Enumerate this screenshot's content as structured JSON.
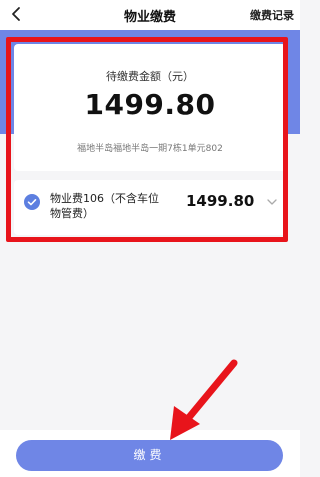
{
  "header": {
    "title": "物业缴费",
    "history_label": "缴费记录",
    "back_icon": "chevron-left-icon"
  },
  "summary": {
    "amount_label": "待缴费金额（元）",
    "amount": "1499.80",
    "address": "福地半岛福地半岛一期7栋1单元802"
  },
  "fee_item": {
    "name": "物业费106（不含车位物管费）",
    "amount": "1499.80",
    "checked": true,
    "check_icon": "check-circle-icon",
    "expand_icon": "chevron-down-icon"
  },
  "footer": {
    "pay_label": "缴费"
  },
  "colors": {
    "accent": "#6f86e6",
    "highlight": "#e8141b"
  }
}
